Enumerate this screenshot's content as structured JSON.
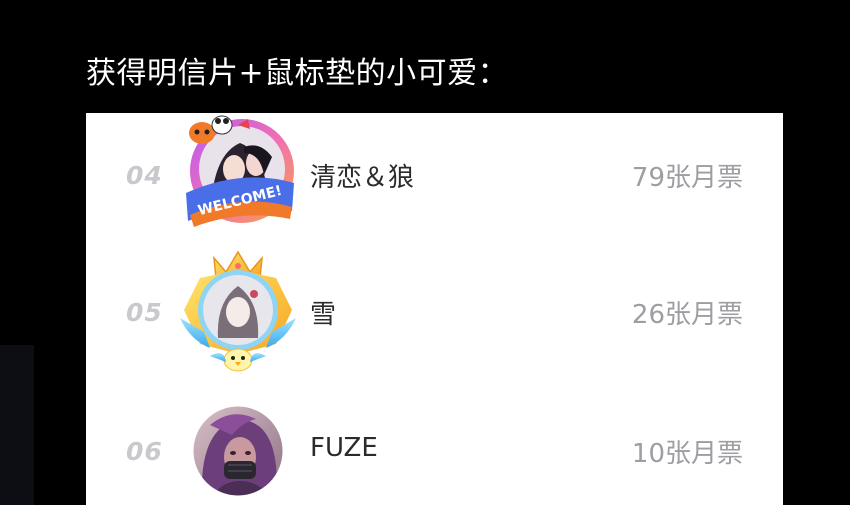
{
  "heading": "获得明信片+鼠标垫的小可爱：",
  "rows": [
    {
      "rank": "04",
      "name": "清恋＆狼",
      "votes": "79张月票",
      "frame": "welcome-badge",
      "badge_text": "WELCOME!"
    },
    {
      "rank": "05",
      "name": "雪",
      "votes": "26张月票",
      "frame": "crown-frame"
    },
    {
      "rank": "06",
      "name": "FUZE",
      "votes": "10张月票",
      "frame": "none"
    }
  ],
  "colors": {
    "background": "#000000",
    "card": "#ffffff",
    "rank": "#c9c9cd",
    "name": "#2b2b2b",
    "votes": "#9d9da2"
  }
}
